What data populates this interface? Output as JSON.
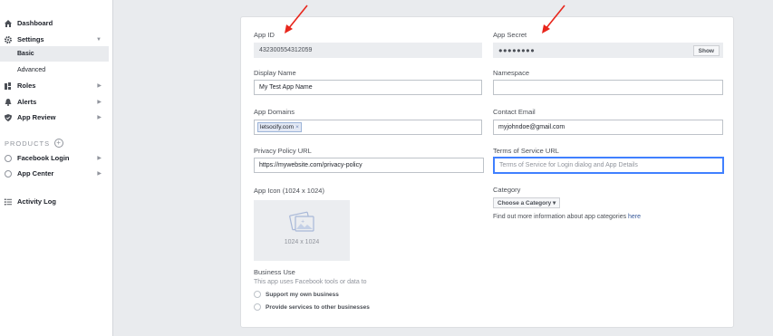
{
  "sidebar": {
    "dashboard": "Dashboard",
    "settings": "Settings",
    "basic": "Basic",
    "advanced": "Advanced",
    "roles": "Roles",
    "alerts": "Alerts",
    "app_review": "App Review",
    "products": "PRODUCTS",
    "facebook_login": "Facebook Login",
    "app_center": "App Center",
    "activity_log": "Activity Log"
  },
  "form": {
    "app_id_label": "App ID",
    "app_id_value": "432300554312059",
    "app_secret_label": "App Secret",
    "app_secret_value": "●●●●●●●●",
    "show_button": "Show",
    "display_name_label": "Display Name",
    "display_name_value": "My Test App Name",
    "namespace_label": "Namespace",
    "namespace_value": "",
    "app_domains_label": "App Domains",
    "app_domain_token": "letsocify.com",
    "contact_email_label": "Contact Email",
    "contact_email_value": "myjohndoe@gmail.com",
    "privacy_label": "Privacy Policy URL",
    "privacy_value": "https://mywebsite.com/privacy-policy",
    "tos_label": "Terms of Service URL",
    "tos_placeholder": "Terms of Service for Login dialog and App Details",
    "app_icon_label": "App Icon (1024 x 1024)",
    "app_icon_dim": "1024 x 1024",
    "category_label": "Category",
    "category_button": "Choose a Category ▾",
    "category_info": "Find out more information about app categories ",
    "category_link": "here",
    "business_use_label": "Business Use",
    "business_use_desc": "This app uses Facebook tools or data to",
    "option_own": "Support my own business",
    "option_other": "Provide services to other businesses"
  },
  "colors": {
    "accent": "#4080ff",
    "arrow": "#e8261c",
    "link": "#365899"
  }
}
